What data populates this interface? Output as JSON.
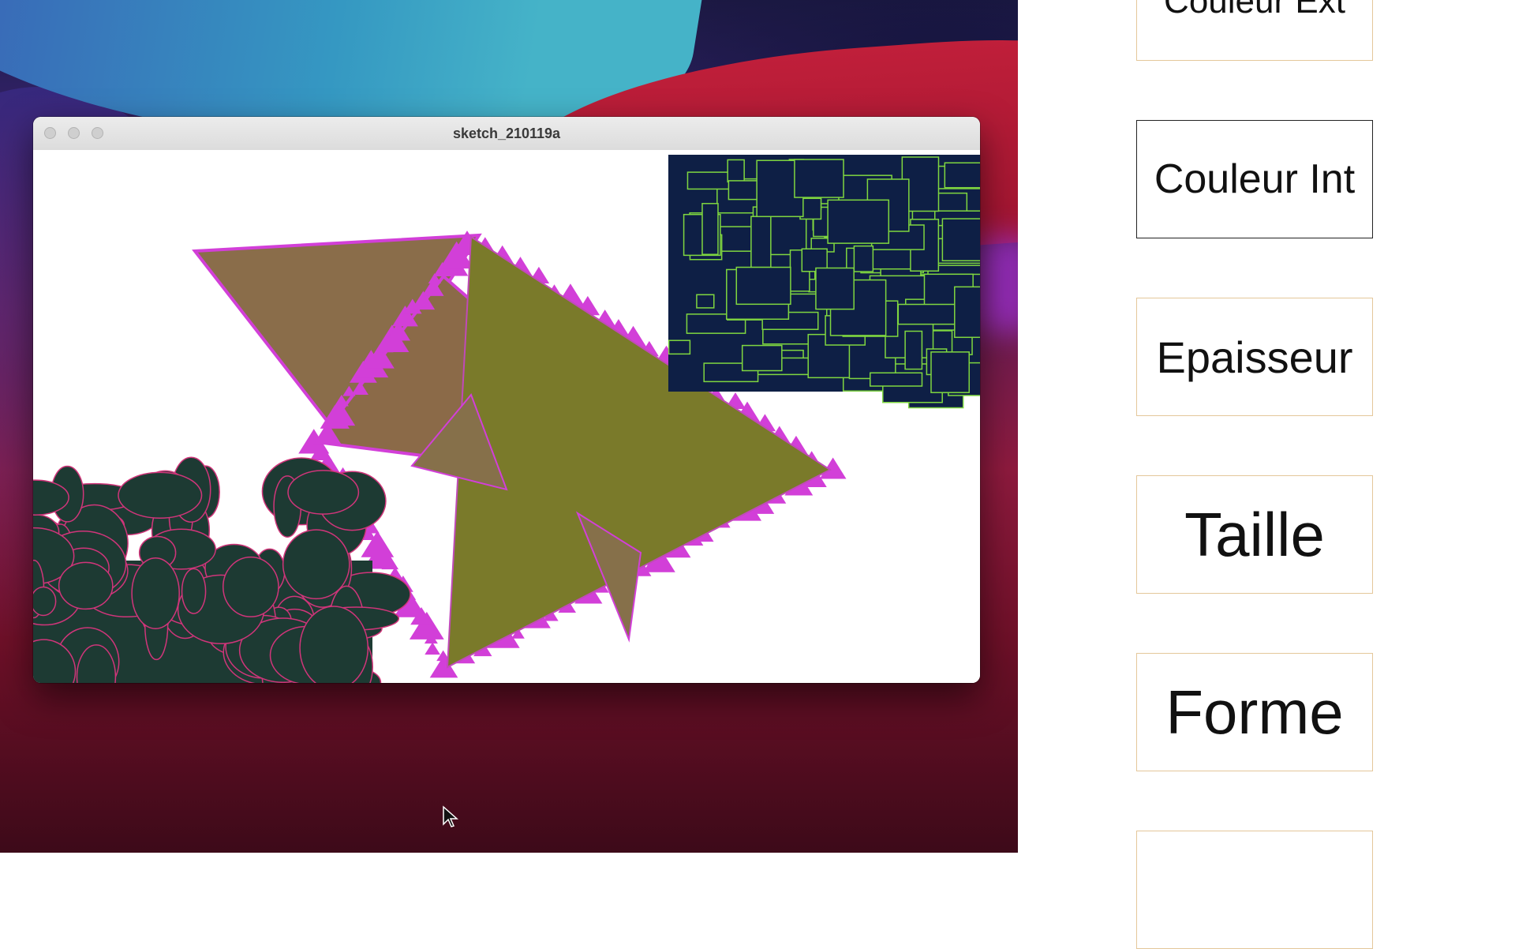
{
  "window": {
    "title": "sketch_210119a",
    "traffic_lights": [
      "close",
      "minimize",
      "zoom"
    ]
  },
  "panel": {
    "buttons": [
      {
        "label": "Couleur Ext",
        "active": false
      },
      {
        "label": "Couleur Int",
        "active": true
      },
      {
        "label": "Epaisseur",
        "active": false
      },
      {
        "label": "Taille",
        "active": false
      },
      {
        "label": "Forme",
        "active": false
      },
      {
        "label": "",
        "active": false
      }
    ]
  },
  "colors": {
    "triangle_fill": "#7a7a2a",
    "fractal_edge": "#d23fd8",
    "rect_fill": "#0e1f45",
    "rect_stroke": "#7fd640",
    "ellipse_fill": "#1d3a33",
    "ellipse_stroke": "#d0357a",
    "button_border": "#e4c79a"
  }
}
